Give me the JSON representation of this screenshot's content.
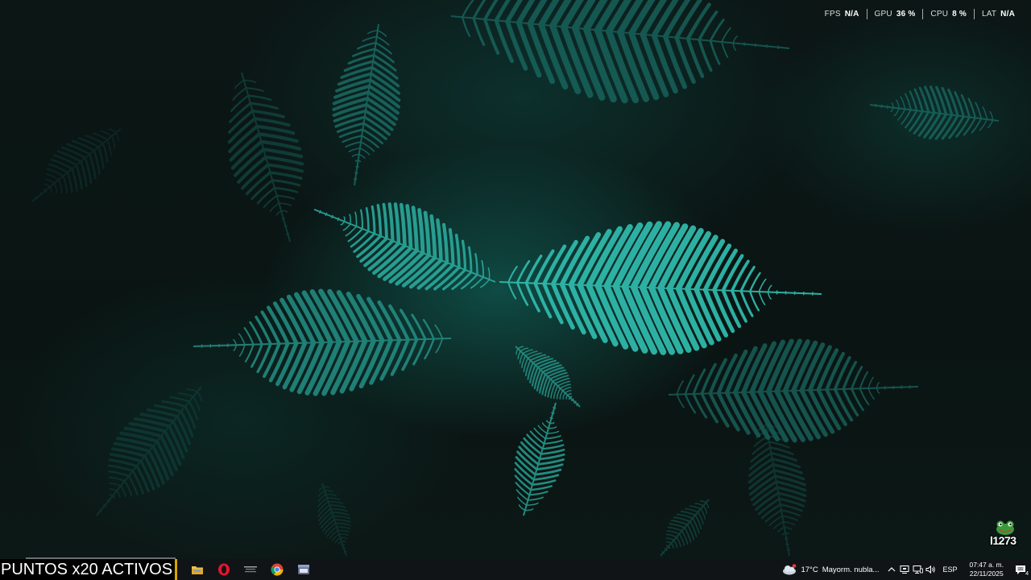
{
  "performance_overlay": {
    "items": [
      {
        "label": "FPS",
        "value": "N/A"
      },
      {
        "label": "GPU",
        "value": "36 %"
      },
      {
        "label": "CPU",
        "value": "8 %"
      },
      {
        "label": "LAT",
        "value": "N/A"
      }
    ]
  },
  "corner_logo": {
    "text": "l1273"
  },
  "points_banner": {
    "text": "PUNTOS x20 ACTIVOS"
  },
  "taskbar": {
    "apps": [
      {
        "name": "file-explorer-icon"
      },
      {
        "name": "opera-icon"
      },
      {
        "name": "app-logo-icon"
      },
      {
        "name": "chrome-icon"
      },
      {
        "name": "window-app-icon"
      }
    ]
  },
  "tray": {
    "weather": {
      "temp": "17°C",
      "desc": "Mayorm. nubla..."
    },
    "language": "ESP",
    "time": "07:47 a. m.",
    "date": "22/11/2025",
    "notification_count": "4"
  },
  "colors": {
    "taskbar_bg": "#101417",
    "banner_border": "#d9a400",
    "fern": "#2fb8aa"
  }
}
